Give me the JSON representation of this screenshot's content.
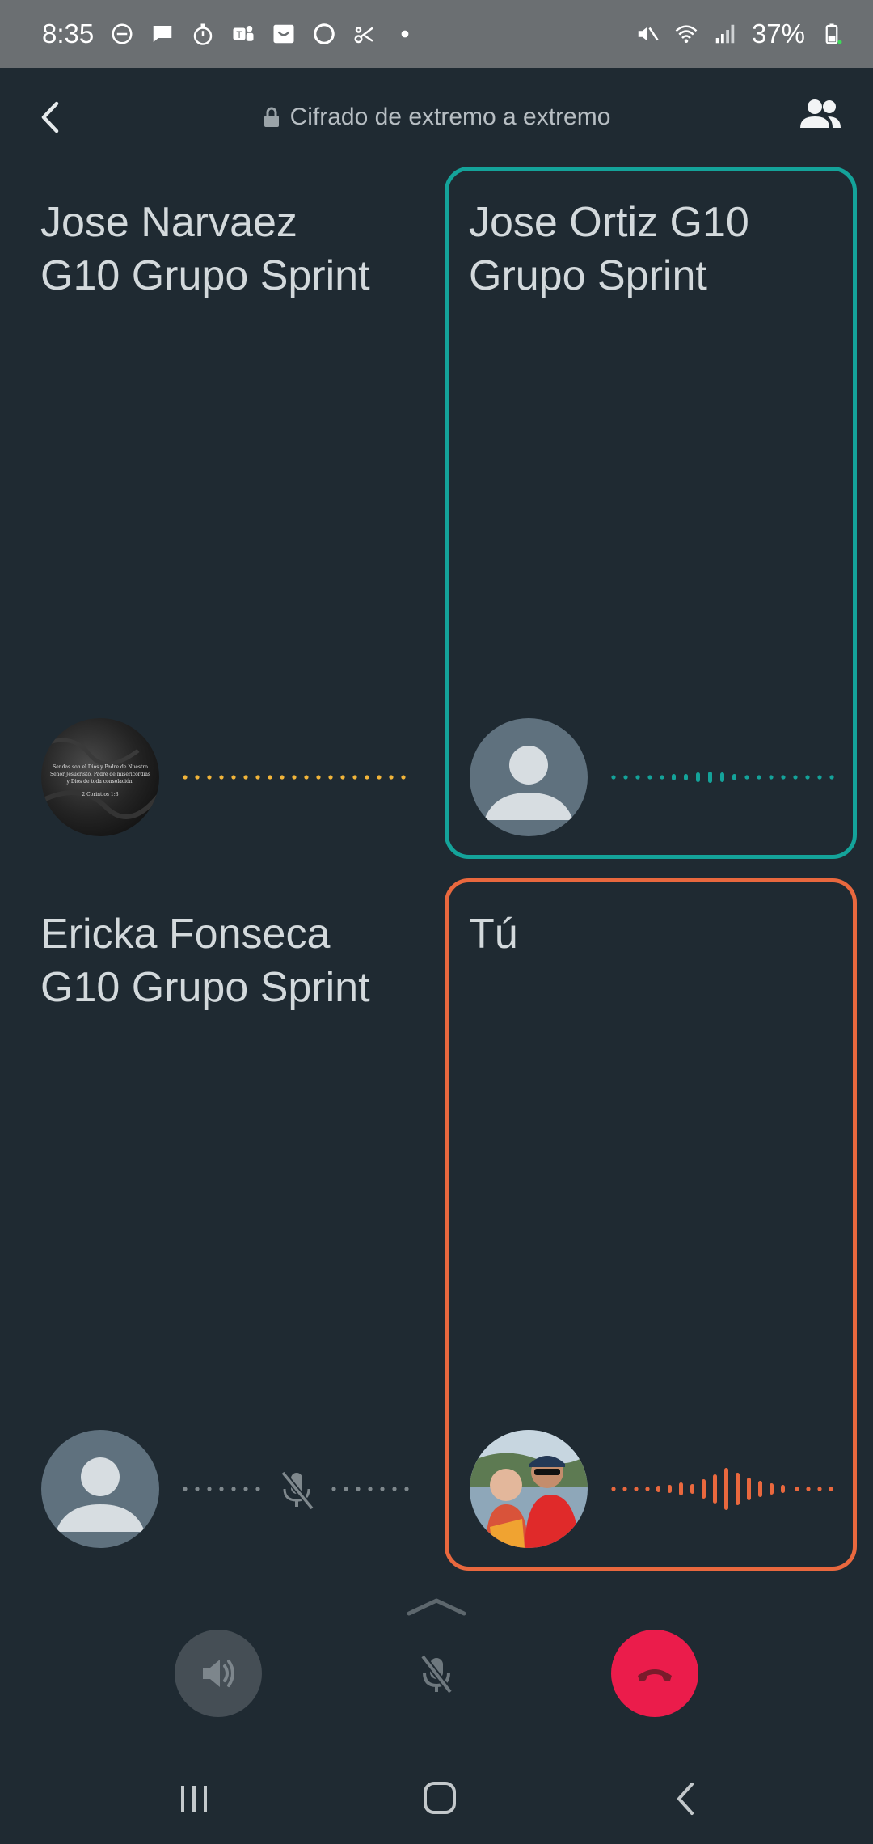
{
  "status_bar": {
    "time": "8:35",
    "battery": "37%",
    "left_icons": [
      "dnd-icon",
      "message-icon",
      "timer-icon",
      "teams-icon",
      "inbox-icon",
      "circle-icon",
      "scissors-icon",
      "dot-icon"
    ],
    "right_icons": [
      "mute-icon",
      "wifi-icon",
      "signal-icon",
      "battery-icon"
    ]
  },
  "header": {
    "encryption_text": "Cifrado de extremo a extremo"
  },
  "participants": [
    {
      "name_line1": "Jose Narvaez",
      "name_line2": "G10 Grupo Sprint",
      "status": "idle",
      "wave_color": "#f2b53a"
    },
    {
      "name_line1": "Jose Ortiz G10",
      "name_line2": "Grupo Sprint",
      "status": "speaking",
      "border_color": "#14a39a",
      "wave_color": "#14a39a"
    },
    {
      "name_line1": "Ericka Fonseca",
      "name_line2": "G10 Grupo Sprint",
      "status": "muted",
      "wave_color": "#8a9398"
    },
    {
      "name_line1": "Tú",
      "name_line2": "",
      "status": "speaking",
      "border_color": "#e9683e",
      "wave_color": "#e9683e"
    }
  ],
  "avatar_text": {
    "line1": "Sendas son el Dios y Padre de Nuestro",
    "line2": "Señor Jesucristo, Padre de misericordias",
    "line3": "y Dios de toda consolación.",
    "line4": "2 Corintios 1:3"
  },
  "controls": {
    "speaker": "speaker-icon",
    "mute": "mic-off-icon",
    "end": "end-call-icon",
    "end_color": "#eb1c4b"
  }
}
